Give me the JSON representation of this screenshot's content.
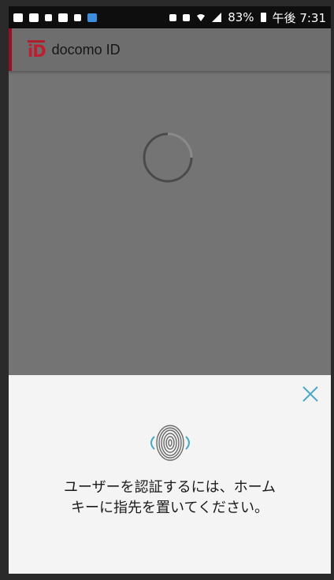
{
  "status_bar": {
    "battery_percent": "83%",
    "time": "午後 7:31"
  },
  "app_bar": {
    "logo_text": "iD",
    "title": "docomo ID",
    "accent_color": "#9a1020"
  },
  "loading": {
    "icon": "spinner-icon"
  },
  "sheet": {
    "close_icon": "close-icon",
    "fingerprint_icon": "fingerprint-icon",
    "message_line1": "ユーザーを認証するには、ホーム",
    "message_line2": "キーに指先を置いてください。",
    "accent_color": "#4aa8c8"
  }
}
